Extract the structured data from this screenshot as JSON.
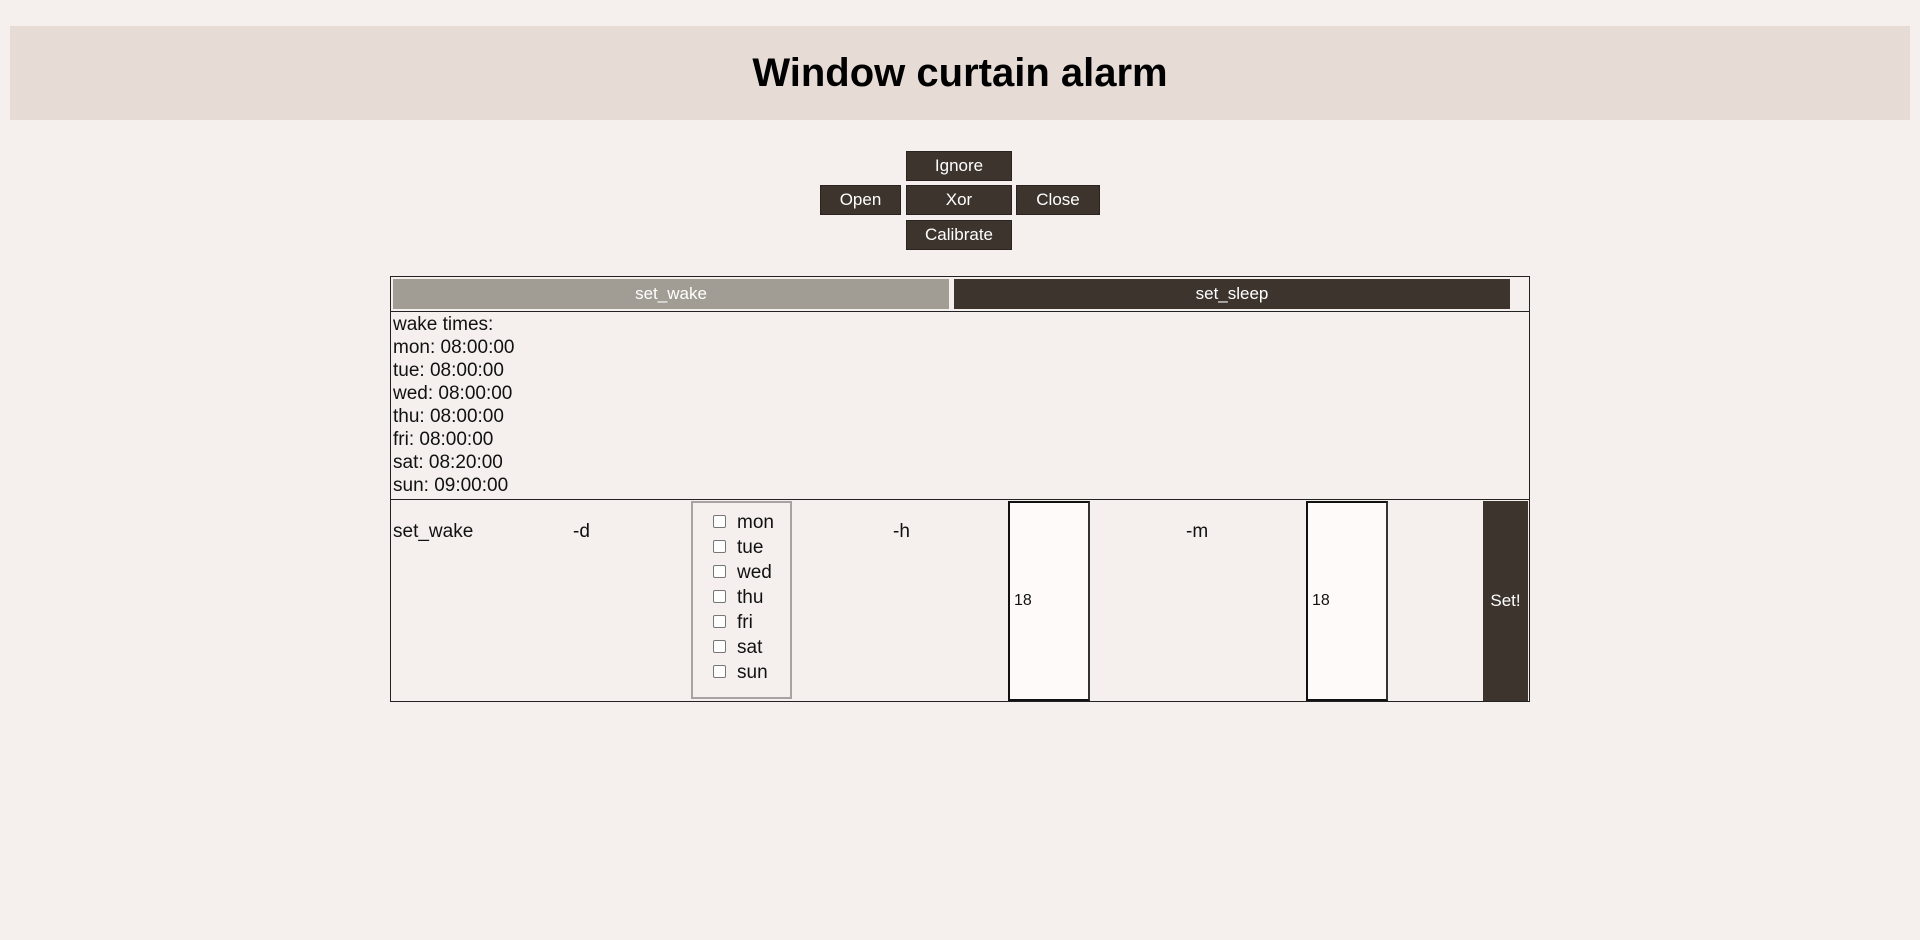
{
  "page": {
    "title": "Window curtain alarm"
  },
  "controls": {
    "ignore": "Ignore",
    "open": "Open",
    "xor": "Xor",
    "close": "Close",
    "calibrate": "Calibrate"
  },
  "tabs": {
    "set_wake": "set_wake",
    "set_sleep": "set_sleep",
    "active": "set_wake"
  },
  "wake_times": {
    "heading": "wake times:",
    "lines": [
      "mon: 08:00:00",
      "tue: 08:00:00",
      "wed: 08:00:00",
      "thu: 08:00:00",
      "fri: 08:00:00",
      "sat: 08:20:00",
      "sun: 09:00:00"
    ]
  },
  "form": {
    "command_label": "set_wake",
    "day_flag": "-d",
    "hour_flag": "-h",
    "minute_flag": "-m",
    "days": [
      "mon",
      "tue",
      "wed",
      "thu",
      "fri",
      "sat",
      "sun"
    ],
    "hour_value": "18",
    "minute_value": "18",
    "submit_label": "Set!"
  },
  "colors": {
    "background": "#f5f0ed",
    "header_background": "#e6dbd5",
    "button_dark": "#3d342e",
    "tab_active": "#a29d94",
    "input_background": "#fffafa"
  }
}
